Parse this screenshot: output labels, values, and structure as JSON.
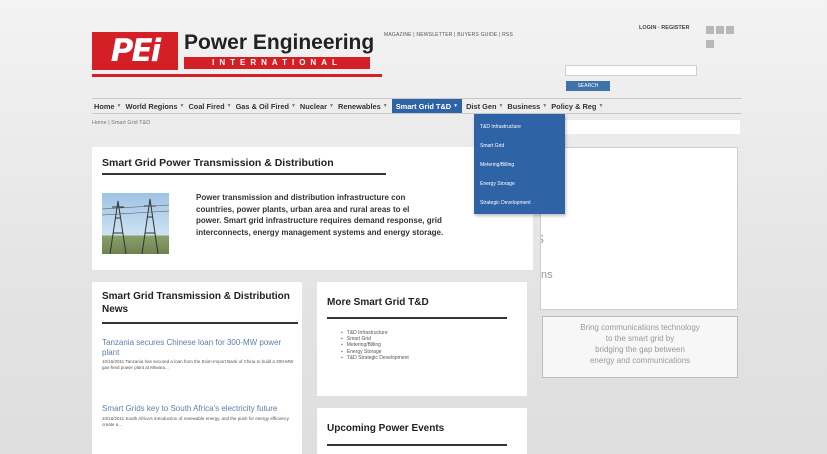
{
  "header": {
    "logo_mark": "PEi",
    "logo_title": "Power Engineering",
    "logo_subtitle": "INTERNATIONAL",
    "top_links": "MAGAZINE | NEWSLETTER | BUYERS GUIDE | RSS",
    "login_links": "LOGIN · REGISTER",
    "search_button": "SEARCH"
  },
  "nav": {
    "items": [
      {
        "label": "Home"
      },
      {
        "label": "World Regions"
      },
      {
        "label": "Coal Fired"
      },
      {
        "label": "Gas & Oil Fired"
      },
      {
        "label": "Nuclear"
      },
      {
        "label": "Renewables"
      },
      {
        "label": "Smart Grid T&D"
      },
      {
        "label": "Dist Gen"
      },
      {
        "label": "Business"
      },
      {
        "label": "Policy & Reg"
      }
    ],
    "caret": "▼"
  },
  "breadcrumb": "Home | Smart Grid T&D",
  "dropdown": {
    "items": [
      "T&D Infrastructure",
      "Smart Grid",
      "Metering/Billing",
      "Energy Storage",
      "Strategic Development"
    ]
  },
  "hero": {
    "title": "Smart Grid Power Transmission & Distribution",
    "lines": [
      "Power transmission and distribution infrastructure con",
      "countries, power plants, urban area and rural areas to el",
      "power.  Smart grid infrastructure requires demand response, grid",
      "interconnects, energy management systems and energy storage."
    ]
  },
  "side": {
    "fragment1": "s",
    "fragment2": "ns",
    "ad_lines": [
      "Bring communications technology",
      "to the smart grid by",
      "bridging the gap between",
      "energy and communications"
    ]
  },
  "news": {
    "title": "Smart Grid Transmission & Distribution News",
    "articles": [
      {
        "title": "Tanzania secures Chinese loan for 300-MW power plant",
        "text": "10/16/2011 Tanzania has secured a loan from the Exim-Import Bank of China to build a 300-MW gas-fired power plant at Mtwara..."
      },
      {
        "title": "Smart Grids key to South Africa's electricity future",
        "text": "10/16/2011 South Africa's introduction of renewable energy, and the push for energy efficiency create a..."
      }
    ]
  },
  "more": {
    "title": "More Smart Grid T&D",
    "items": [
      "T&D Infrastructure",
      "Smart Grid",
      "Metering/Billing",
      "Energy Storage",
      "T&D Strategic Development"
    ]
  },
  "events": {
    "title": "Upcoming Power Events"
  },
  "colors": {
    "brand_red": "#d51f26",
    "nav_active_blue": "#2e63a6",
    "link_blue": "#5a7fb1"
  }
}
